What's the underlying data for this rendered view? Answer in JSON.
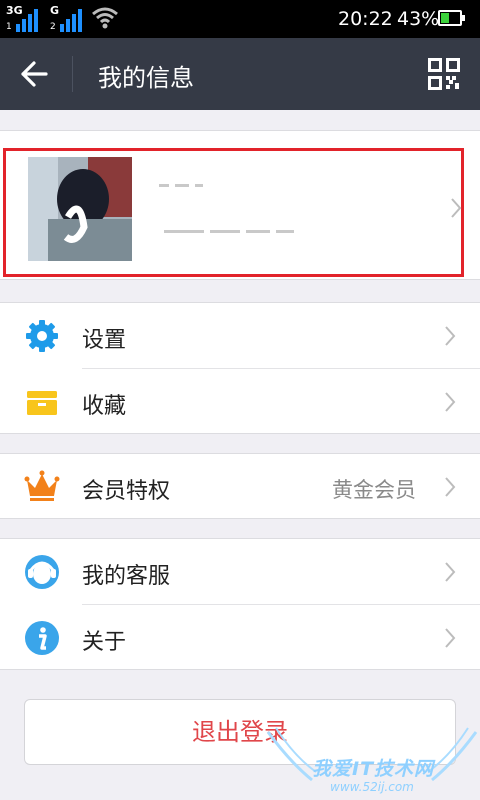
{
  "status_bar": {
    "network1": "3G",
    "network1_index": "1",
    "network2": "G",
    "network2_index": "2",
    "time": "20:22",
    "battery_percent": "43%",
    "battery_level": 0.43
  },
  "titlebar": {
    "title": "我的信息",
    "back_icon": "arrow-left-icon",
    "qr_icon": "qr-code-icon"
  },
  "menu": {
    "settings": {
      "label": "设置",
      "icon": "gear-icon",
      "color": "#1e9be9"
    },
    "favorites": {
      "label": "收藏",
      "icon": "folder-icon",
      "color": "#f8c51c"
    },
    "vip": {
      "label": "会员特权",
      "value": "黄金会员",
      "icon": "crown-icon",
      "color": "#f2811a"
    },
    "service": {
      "label": "我的客服",
      "icon": "customer-service-icon",
      "color": "#3aa5ea"
    },
    "about": {
      "label": "关于",
      "icon": "info-icon",
      "color": "#3aa5ea"
    }
  },
  "logout": {
    "label": "退出登录"
  },
  "watermark": {
    "line1": "我爱IT技术网",
    "line2": "www.52ij.com"
  },
  "colors": {
    "titlebar": "#353a46",
    "highlight": "#e2232a",
    "logout_text": "#e0464a"
  }
}
